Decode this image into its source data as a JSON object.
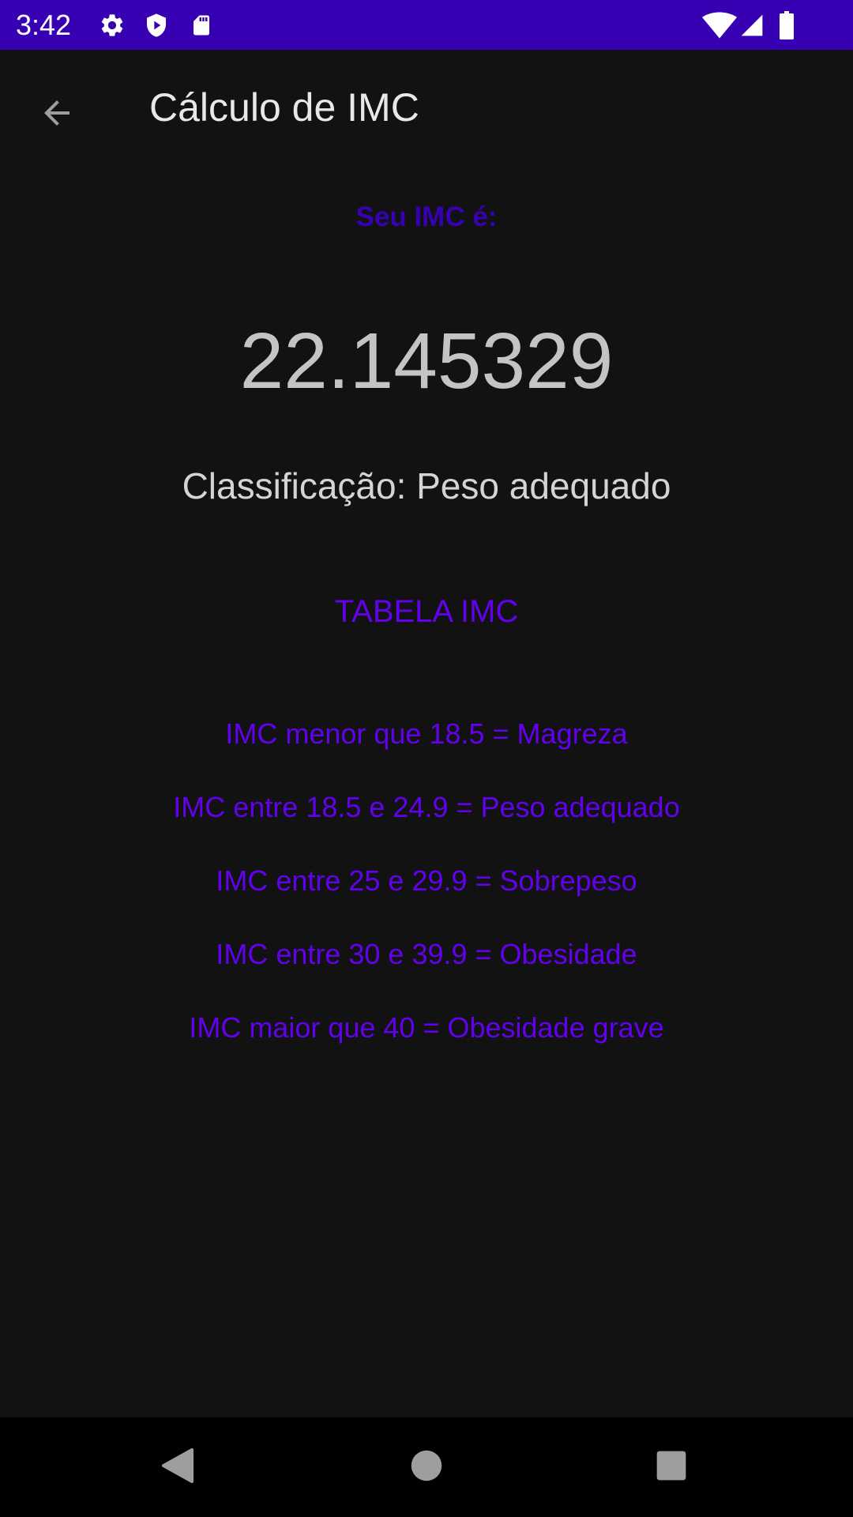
{
  "status_bar": {
    "time": "3:42",
    "background_color": "#3700B3",
    "icons_left": [
      "gear-icon",
      "shield-play-icon",
      "sd-card-icon"
    ],
    "icons_right": [
      "wifi-icon",
      "signal-icon",
      "battery-icon"
    ]
  },
  "app_bar": {
    "title": "Cálculo de IMC",
    "back_icon": "arrow-back-icon"
  },
  "result": {
    "label": "Seu IMC é:",
    "value": "22.145329",
    "classification": "Classificação: Peso adequado"
  },
  "table": {
    "title": "TABELA IMC",
    "rows": [
      "IMC menor que 18.5 = Magreza",
      "IMC entre 18.5 e 24.9 = Peso adequado",
      "IMC entre 25 e 29.9 = Sobrepeso",
      "IMC entre 30 e 39.9 = Obesidade",
      "IMC maior que 40 = Obesidade grave"
    ]
  },
  "nav_bar": {
    "buttons": [
      "nav-back-icon",
      "nav-home-icon",
      "nav-recents-icon"
    ]
  },
  "colors": {
    "accent_dark": "#3700B3",
    "accent": "#6200EE",
    "background": "#121212"
  }
}
